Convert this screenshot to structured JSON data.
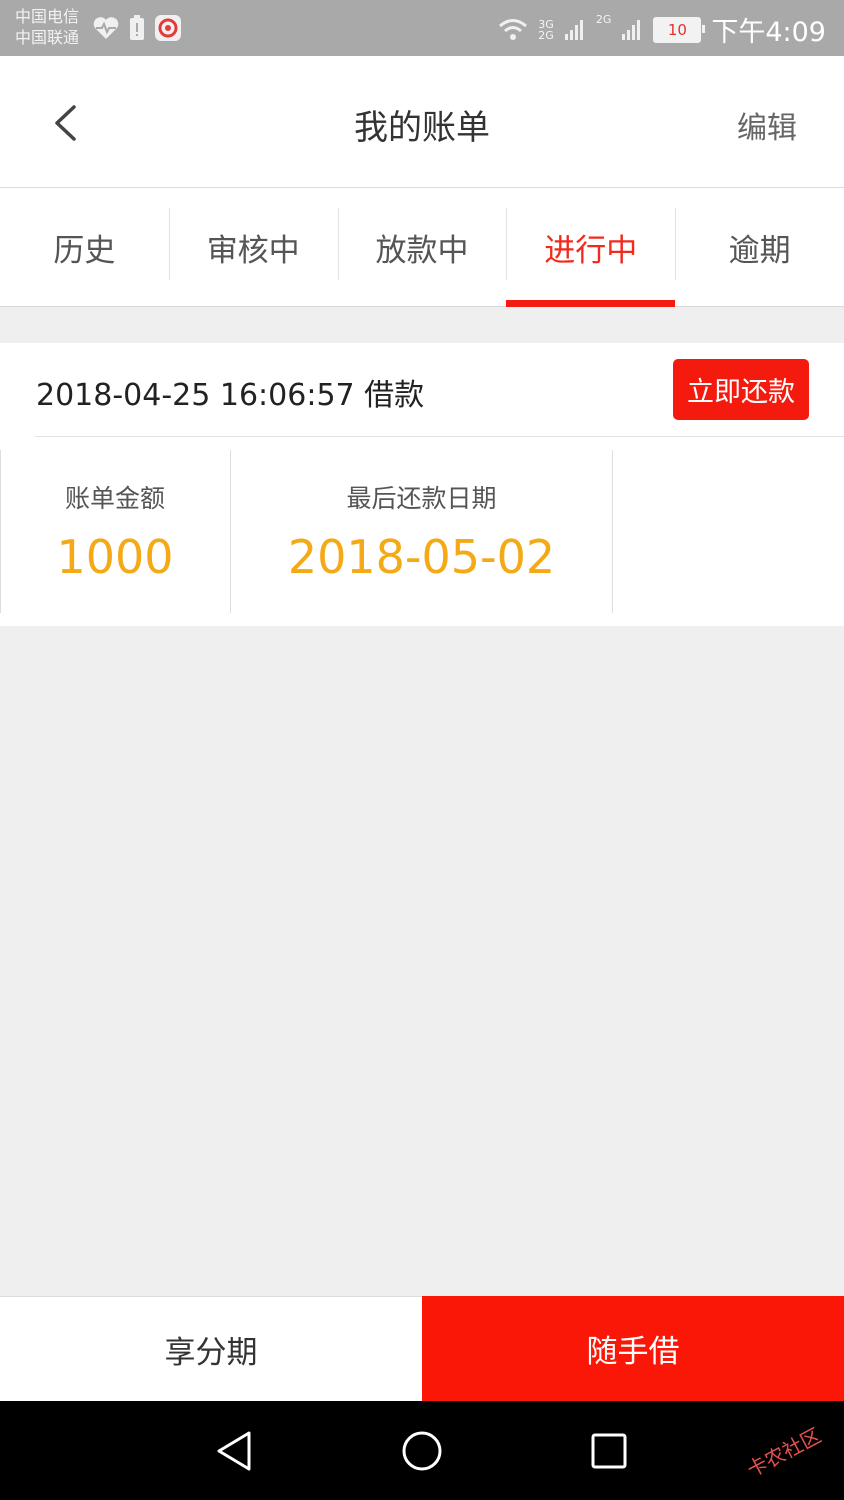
{
  "status_bar": {
    "carrier_1": "中国电信",
    "carrier_2": "中国联通",
    "sig_1_top": "3G",
    "sig_1_bottom": "2G",
    "sig_2_top": "2G",
    "battery": "10",
    "time": "下午4:09"
  },
  "header": {
    "back_icon": "chevron-left-icon",
    "title": "我的账单",
    "edit": "编辑"
  },
  "tabs": [
    {
      "label": "历史"
    },
    {
      "label": "审核中"
    },
    {
      "label": "放款中"
    },
    {
      "label": "进行中",
      "active": true
    },
    {
      "label": "逾期"
    }
  ],
  "bill": {
    "date": "2018-04-25 16:06:57 借款",
    "repay_button": "立即还款",
    "amount_label": "账单金额",
    "amount_value": "1000",
    "due_label": "最后还款日期",
    "due_value": "2018-05-02"
  },
  "bottom_bar": {
    "left": "享分期",
    "right": "随手借"
  },
  "nav": {
    "back": "triangle-back-icon",
    "home": "circle-home-icon",
    "recent": "square-recents-icon"
  },
  "watermark": "卡农社区",
  "colors": {
    "accent_red": "#f21d10",
    "value_orange": "#f4a917"
  }
}
